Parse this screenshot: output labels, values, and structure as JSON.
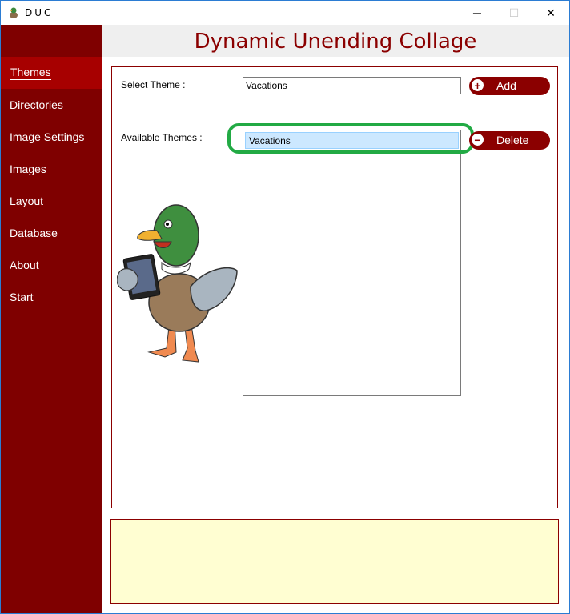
{
  "window": {
    "title": "DUC",
    "controls": {
      "minimize": "─",
      "maximize": "☐",
      "close": "✕"
    }
  },
  "app": {
    "title": "Dynamic Unending Collage"
  },
  "sidebar": {
    "items": [
      {
        "label": "Themes",
        "active": true
      },
      {
        "label": "Directories"
      },
      {
        "label": "Image Settings"
      },
      {
        "label": "Images"
      },
      {
        "label": "Layout"
      },
      {
        "label": "Database"
      },
      {
        "label": "About"
      },
      {
        "label": "Start"
      }
    ]
  },
  "themes": {
    "select_label": "Select Theme :",
    "select_value": "Vacations",
    "available_label": "Available Themes :",
    "available": [
      "Vacations"
    ],
    "add_label": "Add",
    "add_icon": "plus-icon",
    "delete_label": "Delete",
    "delete_icon": "minus-icon"
  },
  "status": {
    "text": ""
  },
  "colors": {
    "sidebar": "#7f0000",
    "sidebar_active": "#a70000",
    "accent": "#8b0000",
    "highlight": "#22aa44",
    "status_bg": "#fffed2"
  }
}
